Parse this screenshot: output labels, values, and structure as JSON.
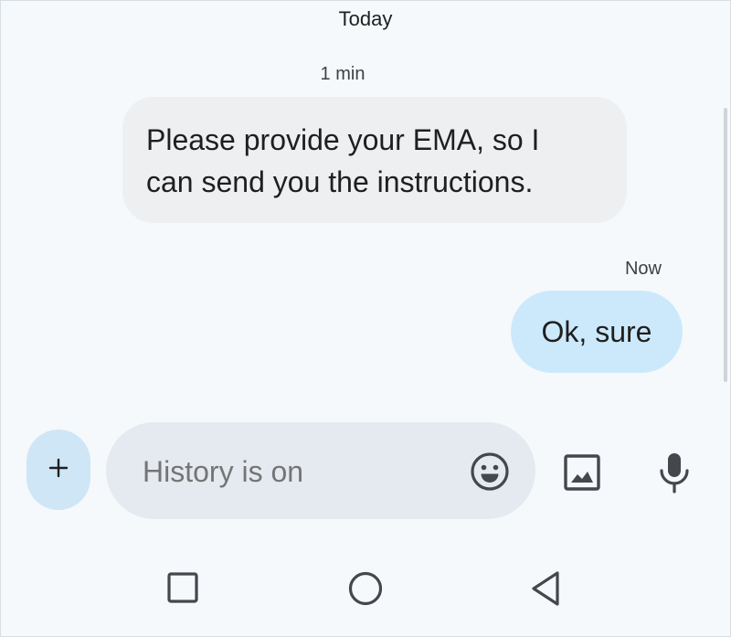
{
  "conversation": {
    "day_label": "Today",
    "messages": [
      {
        "direction": "incoming",
        "timestamp": "1 min",
        "lines": [
          "Please provide your EMA, so I",
          "can send you the instructions."
        ]
      },
      {
        "direction": "outgoing",
        "timestamp": "Now",
        "text": "Ok, sure"
      }
    ]
  },
  "composer": {
    "add_button_label": "+",
    "placeholder": "History is on",
    "icons": [
      "emoji-icon",
      "image-icon",
      "mic-icon"
    ]
  },
  "nav_bar": {
    "icons": [
      "recents-icon",
      "home-icon",
      "back-icon"
    ]
  },
  "colors": {
    "background": "#f5f9fc",
    "incoming_bubble": "#eeeff1",
    "outgoing_bubble": "#cce9fb",
    "compose_field": "#e5eaf0",
    "add_button": "#cfe6f6",
    "icon": "#44474b"
  }
}
